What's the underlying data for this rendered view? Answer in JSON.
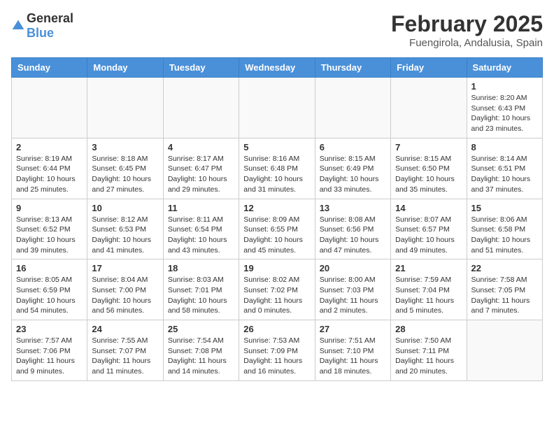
{
  "header": {
    "logo": {
      "general": "General",
      "blue": "Blue"
    },
    "month": "February 2025",
    "location": "Fuengirola, Andalusia, Spain"
  },
  "weekdays": [
    "Sunday",
    "Monday",
    "Tuesday",
    "Wednesday",
    "Thursday",
    "Friday",
    "Saturday"
  ],
  "weeks": [
    [
      {
        "day": "",
        "info": ""
      },
      {
        "day": "",
        "info": ""
      },
      {
        "day": "",
        "info": ""
      },
      {
        "day": "",
        "info": ""
      },
      {
        "day": "",
        "info": ""
      },
      {
        "day": "",
        "info": ""
      },
      {
        "day": "1",
        "info": "Sunrise: 8:20 AM\nSunset: 6:43 PM\nDaylight: 10 hours\nand 23 minutes."
      }
    ],
    [
      {
        "day": "2",
        "info": "Sunrise: 8:19 AM\nSunset: 6:44 PM\nDaylight: 10 hours\nand 25 minutes."
      },
      {
        "day": "3",
        "info": "Sunrise: 8:18 AM\nSunset: 6:45 PM\nDaylight: 10 hours\nand 27 minutes."
      },
      {
        "day": "4",
        "info": "Sunrise: 8:17 AM\nSunset: 6:47 PM\nDaylight: 10 hours\nand 29 minutes."
      },
      {
        "day": "5",
        "info": "Sunrise: 8:16 AM\nSunset: 6:48 PM\nDaylight: 10 hours\nand 31 minutes."
      },
      {
        "day": "6",
        "info": "Sunrise: 8:15 AM\nSunset: 6:49 PM\nDaylight: 10 hours\nand 33 minutes."
      },
      {
        "day": "7",
        "info": "Sunrise: 8:15 AM\nSunset: 6:50 PM\nDaylight: 10 hours\nand 35 minutes."
      },
      {
        "day": "8",
        "info": "Sunrise: 8:14 AM\nSunset: 6:51 PM\nDaylight: 10 hours\nand 37 minutes."
      }
    ],
    [
      {
        "day": "9",
        "info": "Sunrise: 8:13 AM\nSunset: 6:52 PM\nDaylight: 10 hours\nand 39 minutes."
      },
      {
        "day": "10",
        "info": "Sunrise: 8:12 AM\nSunset: 6:53 PM\nDaylight: 10 hours\nand 41 minutes."
      },
      {
        "day": "11",
        "info": "Sunrise: 8:11 AM\nSunset: 6:54 PM\nDaylight: 10 hours\nand 43 minutes."
      },
      {
        "day": "12",
        "info": "Sunrise: 8:09 AM\nSunset: 6:55 PM\nDaylight: 10 hours\nand 45 minutes."
      },
      {
        "day": "13",
        "info": "Sunrise: 8:08 AM\nSunset: 6:56 PM\nDaylight: 10 hours\nand 47 minutes."
      },
      {
        "day": "14",
        "info": "Sunrise: 8:07 AM\nSunset: 6:57 PM\nDaylight: 10 hours\nand 49 minutes."
      },
      {
        "day": "15",
        "info": "Sunrise: 8:06 AM\nSunset: 6:58 PM\nDaylight: 10 hours\nand 51 minutes."
      }
    ],
    [
      {
        "day": "16",
        "info": "Sunrise: 8:05 AM\nSunset: 6:59 PM\nDaylight: 10 hours\nand 54 minutes."
      },
      {
        "day": "17",
        "info": "Sunrise: 8:04 AM\nSunset: 7:00 PM\nDaylight: 10 hours\nand 56 minutes."
      },
      {
        "day": "18",
        "info": "Sunrise: 8:03 AM\nSunset: 7:01 PM\nDaylight: 10 hours\nand 58 minutes."
      },
      {
        "day": "19",
        "info": "Sunrise: 8:02 AM\nSunset: 7:02 PM\nDaylight: 11 hours\nand 0 minutes."
      },
      {
        "day": "20",
        "info": "Sunrise: 8:00 AM\nSunset: 7:03 PM\nDaylight: 11 hours\nand 2 minutes."
      },
      {
        "day": "21",
        "info": "Sunrise: 7:59 AM\nSunset: 7:04 PM\nDaylight: 11 hours\nand 5 minutes."
      },
      {
        "day": "22",
        "info": "Sunrise: 7:58 AM\nSunset: 7:05 PM\nDaylight: 11 hours\nand 7 minutes."
      }
    ],
    [
      {
        "day": "23",
        "info": "Sunrise: 7:57 AM\nSunset: 7:06 PM\nDaylight: 11 hours\nand 9 minutes."
      },
      {
        "day": "24",
        "info": "Sunrise: 7:55 AM\nSunset: 7:07 PM\nDaylight: 11 hours\nand 11 minutes."
      },
      {
        "day": "25",
        "info": "Sunrise: 7:54 AM\nSunset: 7:08 PM\nDaylight: 11 hours\nand 14 minutes."
      },
      {
        "day": "26",
        "info": "Sunrise: 7:53 AM\nSunset: 7:09 PM\nDaylight: 11 hours\nand 16 minutes."
      },
      {
        "day": "27",
        "info": "Sunrise: 7:51 AM\nSunset: 7:10 PM\nDaylight: 11 hours\nand 18 minutes."
      },
      {
        "day": "28",
        "info": "Sunrise: 7:50 AM\nSunset: 7:11 PM\nDaylight: 11 hours\nand 20 minutes."
      },
      {
        "day": "",
        "info": ""
      }
    ]
  ]
}
